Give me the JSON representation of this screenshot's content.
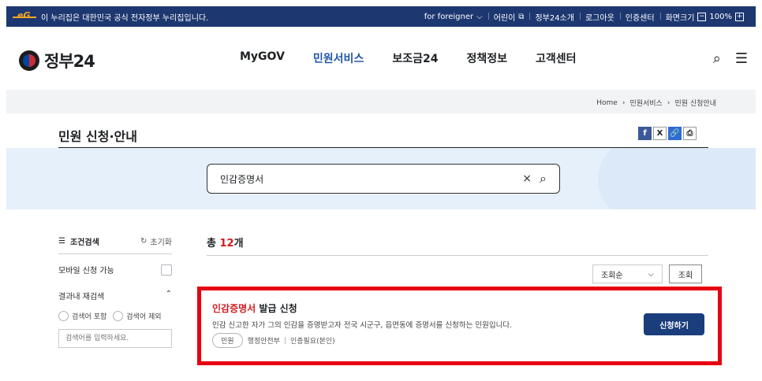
{
  "govbar": {
    "notice": "이 누리집은 대한민국 공식 전자정부 누리집입니다.",
    "links": [
      "for foreigner",
      "어린이",
      "정부24소개",
      "로그아웃",
      "인증센터",
      "화면크기"
    ],
    "zoom": "100%",
    "zoom_minus": "−",
    "zoom_plus": "+"
  },
  "header": {
    "logo": "정부24",
    "nav": [
      "MyGOV",
      "민원서비스",
      "보조금24",
      "정책정보",
      "고객센터"
    ],
    "active_nav": "민원서비스",
    "search_icon": "⌕",
    "menu_icon": "☰"
  },
  "breadcrumb": [
    "Home",
    "민원서비스",
    "민원 신청안내"
  ],
  "breadcrumb_sep": "›",
  "page_title": "민원 신청·안내",
  "shares": {
    "facebook": "f",
    "x": "X",
    "link": "🔗",
    "print": "⎙"
  },
  "search": {
    "value": "인감증명서",
    "clear": "×",
    "mag": "⌕"
  },
  "sidebar": {
    "title": "조건검색",
    "reset": "초기화",
    "mobile_label": "모바일 신청 가능",
    "refine_title": "결과내 재검색",
    "include": "검색어 포함",
    "exclude": "검색어 제외",
    "placeholder": "검색어를 입력하세요."
  },
  "results": {
    "total_prefix": "총",
    "total_count": "12",
    "total_suffix": "개",
    "sort": "조회순",
    "sort_button": "조회",
    "item": {
      "title_highlight": "인감증명서",
      "title_rest": " 발급 신청",
      "desc": "인감 신고한 자가 그의 인감을 증명받고자 전국 시군구, 읍면동에 증명서를 신청하는 민원입니다.",
      "chip": "민원",
      "agency": "행정안전부",
      "auth": "인증필요(본인)",
      "apply": "신청하기"
    }
  }
}
